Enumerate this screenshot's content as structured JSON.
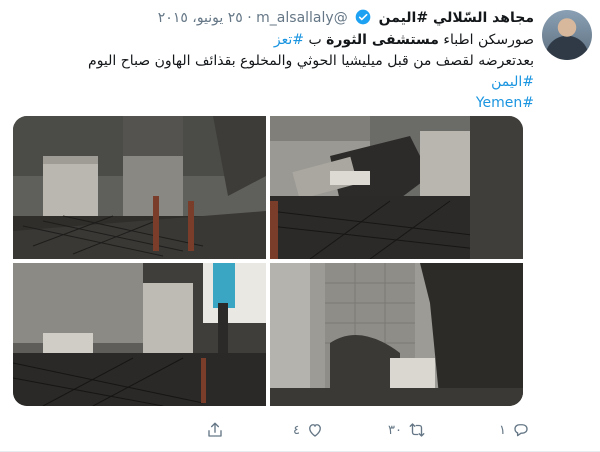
{
  "tweet": {
    "display_name": "مجاهد السّلالي #اليمن",
    "handle": "@m_alsallaly",
    "separator": "·",
    "date": "٢٥ يونيو، ٢٠١٥",
    "text_line1_pre": "صورسكن اطباء ",
    "text_line1_bold": "مستشفى الثورة",
    "text_line1_mid": " ب ",
    "text_line1_tag": "#تعز",
    "text_line2": "بعدتعرضه لقصف من قبل ميليشيا الحوثي والمخلوع بقذائف الهاون صباح اليوم",
    "hashtag_ar": "#اليمن",
    "hashtag_en": "#Yemen"
  },
  "media": {
    "photos": [
      "burned-room-1",
      "burned-room-2",
      "burned-room-3",
      "burned-room-4"
    ]
  },
  "actions": {
    "reply_count": "١",
    "retweet_count": "٣٠",
    "like_count": "٤",
    "icons": [
      "reply-icon",
      "retweet-icon",
      "like-icon",
      "share-icon"
    ]
  },
  "colors": {
    "link": "#1b95e0",
    "muted": "#657786",
    "verified": "#1da1f2"
  }
}
